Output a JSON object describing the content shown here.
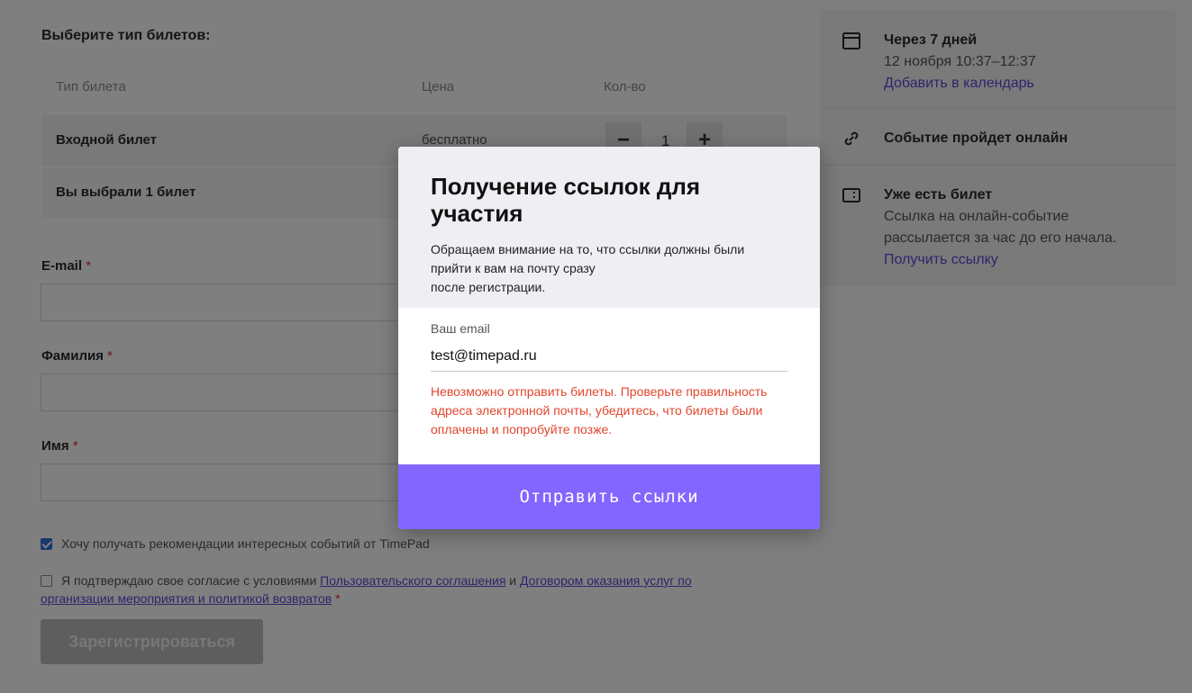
{
  "form": {
    "section_title": "Выберите тип билетов:",
    "table": {
      "headers": [
        "Тип билета",
        "Цена",
        "Кол-во"
      ],
      "rows": [
        {
          "name": "Входной билет",
          "price": "бесплатно",
          "minus": "−",
          "qty": "1",
          "plus": "+"
        }
      ],
      "summary": "Вы выбрали 1 билет"
    },
    "fields": [
      {
        "label": "E-mail",
        "required": "*"
      },
      {
        "label": "Фамилия",
        "required": "*"
      },
      {
        "label": "Имя",
        "required": "*"
      }
    ],
    "subscribe": {
      "checked": true,
      "text": "Хочу получать рекомендации интересных событий от TimePad"
    },
    "agreement": {
      "checked": false,
      "text_before": "Я подтверждаю свое согласие с условиями ",
      "link1": "Пользовательского соглашения",
      "text_and": " и ",
      "link2": "Договором оказания услуг по организации мероприятия и политикой возвратов",
      "required": "*"
    },
    "register_label": "Зарегистрироваться"
  },
  "sidebar": {
    "date": {
      "icon": "calendar-icon",
      "title": "Через 7 дней",
      "subtitle": "12 ноября 10:37–12:37",
      "link": "Добавить в календарь"
    },
    "online": {
      "icon": "link-icon",
      "title": "Событие пройдет онлайн"
    },
    "ticket": {
      "icon": "ticket-icon",
      "title": "Уже есть билет",
      "text_line1": "Ссылка на онлайн-событие",
      "text_line2": "рассылается за час до его начала.",
      "link": "Получить ссылку"
    }
  },
  "modal": {
    "title": "Получение ссылок для участия",
    "desc_line1": "Обращаем внимание на то, что ссылки должны были",
    "desc_line2": "прийти к вам на почту сразу",
    "desc_line3": "после регистрации.",
    "email_label": "Ваш email",
    "email_value": "test@timepad.ru",
    "error": "Невозможно отправить билеты. Проверьте правильность адреса электронной почты, убедитесь, что билеты были оплачены и попробуйте позже.",
    "submit_label": "Отправить ссылки"
  },
  "colors": {
    "accent": "#8366ff",
    "error": "#e2462d",
    "link": "#5b4bd6"
  }
}
